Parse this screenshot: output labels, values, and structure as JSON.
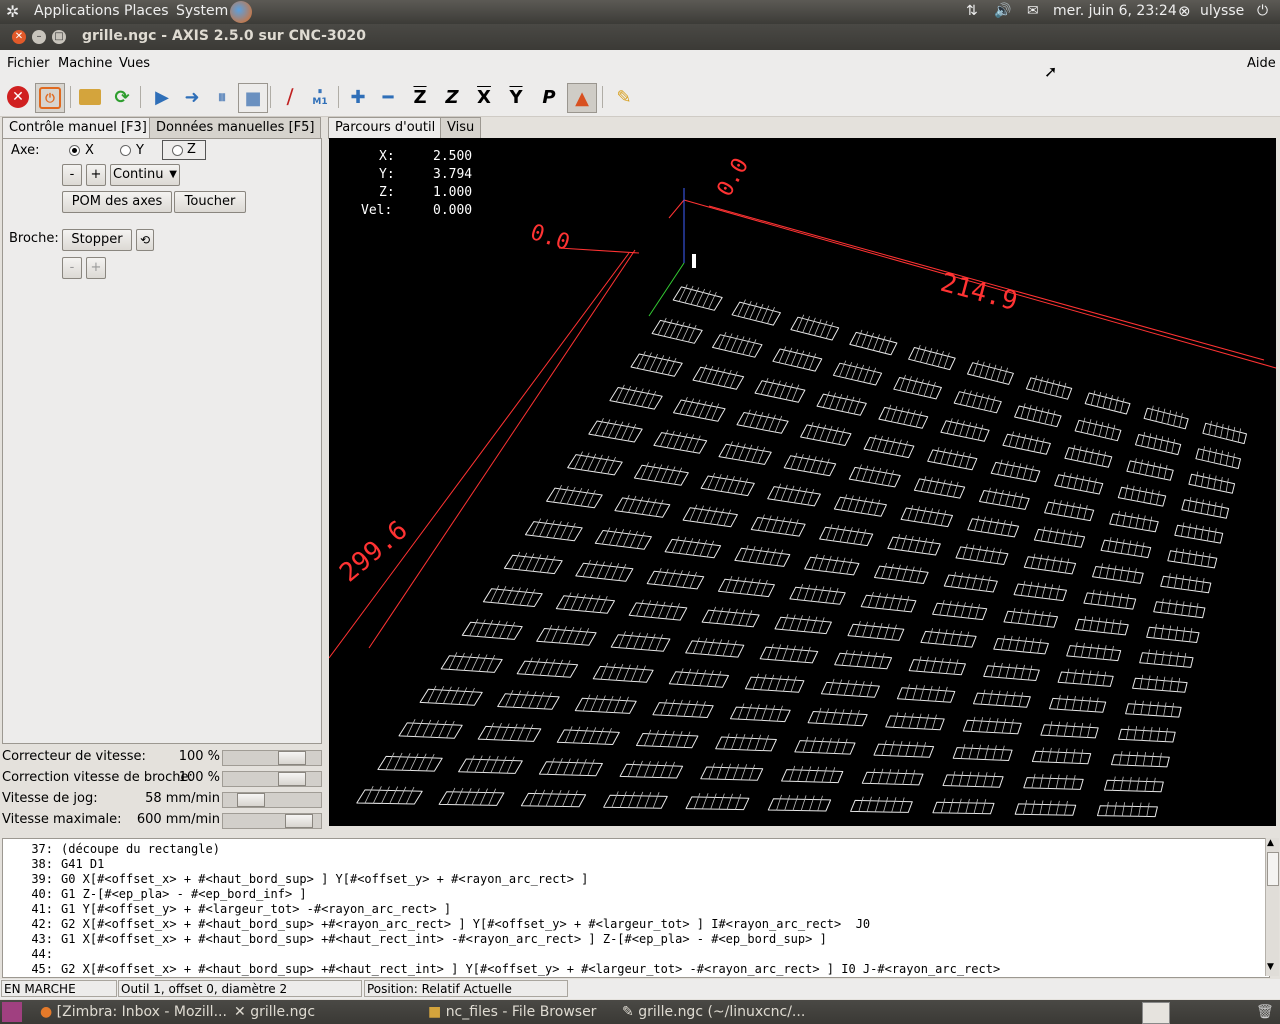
{
  "top_panel": {
    "applications": "Applications",
    "places": "Places",
    "system": "System",
    "datetime": "mer. juin  6, 23:24",
    "user": "ulysse"
  },
  "window": {
    "title": "grille.ngc - AXIS 2.5.0 sur CNC-3020"
  },
  "menu": {
    "fichier": "Fichier",
    "machine": "Machine",
    "vues": "Vues",
    "aide": "Aide"
  },
  "toolbar": {
    "z_btn": "Z",
    "zrot_btn": "Z",
    "x_btn": "X",
    "y_btn": "Y",
    "p_btn": "P",
    "m1_label": "M1"
  },
  "left_tabs": [
    "Contrôle manuel [F3]",
    "Données manuelles [F5]"
  ],
  "manual": {
    "axe_label": "Axe:",
    "axes": [
      "X",
      "Y",
      "Z"
    ],
    "minus": "-",
    "plus": "+",
    "jog_mode": "Continu",
    "home_button": "POM des axes",
    "touch_button": "Toucher",
    "broche_label": "Broche:",
    "stop_button": "Stopper"
  },
  "sliders": [
    {
      "label": "Correcteur de vitesse:",
      "value": "100 %",
      "level": 0.78
    },
    {
      "label": "Correction vitesse de broche:",
      "value": "100 %",
      "level": 0.78
    },
    {
      "label": "Vitesse de jog:",
      "value": "58 mm/min",
      "level": 0.2
    },
    {
      "label": "Vitesse maximale:",
      "value": "600 mm/min",
      "level": 0.88
    }
  ],
  "right_tabs": [
    "Parcours d'outil",
    "Visu"
  ],
  "dro": [
    {
      "axis": "X:",
      "value": "2.500"
    },
    {
      "axis": "Y:",
      "value": "3.794"
    },
    {
      "axis": "Z:",
      "value": "1.000"
    },
    {
      "axis": "Vel:",
      "value": "0.000"
    }
  ],
  "dimensions": {
    "top_dim": "214.9",
    "left_dim": "299.6",
    "origin_a": "0.0",
    "origin_b": "0.0"
  },
  "editor_lines": [
    {
      "n": "37:",
      "code": "(découpe du rectangle)"
    },
    {
      "n": "38:",
      "code": "G41 D1"
    },
    {
      "n": "39:",
      "code": "G0 X[#<offset_x> + #<haut_bord_sup> ] Y[#<offset_y> + #<rayon_arc_rect> ]"
    },
    {
      "n": "40:",
      "code": "G1 Z-[#<ep_pla> - #<ep_bord_inf> ]"
    },
    {
      "n": "41:",
      "code": "G1 Y[#<offset_y> + #<largeur_tot> -#<rayon_arc_rect> ]"
    },
    {
      "n": "42:",
      "code": "G2 X[#<offset_x> + #<haut_bord_sup> +#<rayon_arc_rect> ] Y[#<offset_y> + #<largeur_tot> ] I#<rayon_arc_rect>  J0"
    },
    {
      "n": "43:",
      "code": "G1 X[#<offset_x> + #<haut_bord_sup> +#<haut_rect_int> -#<rayon_arc_rect> ] Z-[#<ep_pla> - #<ep_bord_sup> ]"
    },
    {
      "n": "44:",
      "code": ""
    },
    {
      "n": "45:",
      "code": "G2 X[#<offset_x> + #<haut_bord_sup> +#<haut_rect_int> ] Y[#<offset_y> + #<largeur_tot> -#<rayon_arc_rect> ] I0 J-#<rayon_arc_rect>"
    }
  ],
  "status": {
    "state": "EN MARCHE",
    "tool": "Outil 1, offset 0, diamètre 2",
    "position": "Position: Relatif Actuelle"
  },
  "taskbar": [
    "[Zimbra: Inbox - Mozill...",
    "grille.ngc",
    "nc_files - File Browser",
    "grille.ngc (~/linuxcnc/..."
  ],
  "colors": {
    "accent": "#f07746",
    "viewport_bg": "#000000",
    "dim_red": "#ff3333",
    "toolpath": "#e8e8e8"
  }
}
